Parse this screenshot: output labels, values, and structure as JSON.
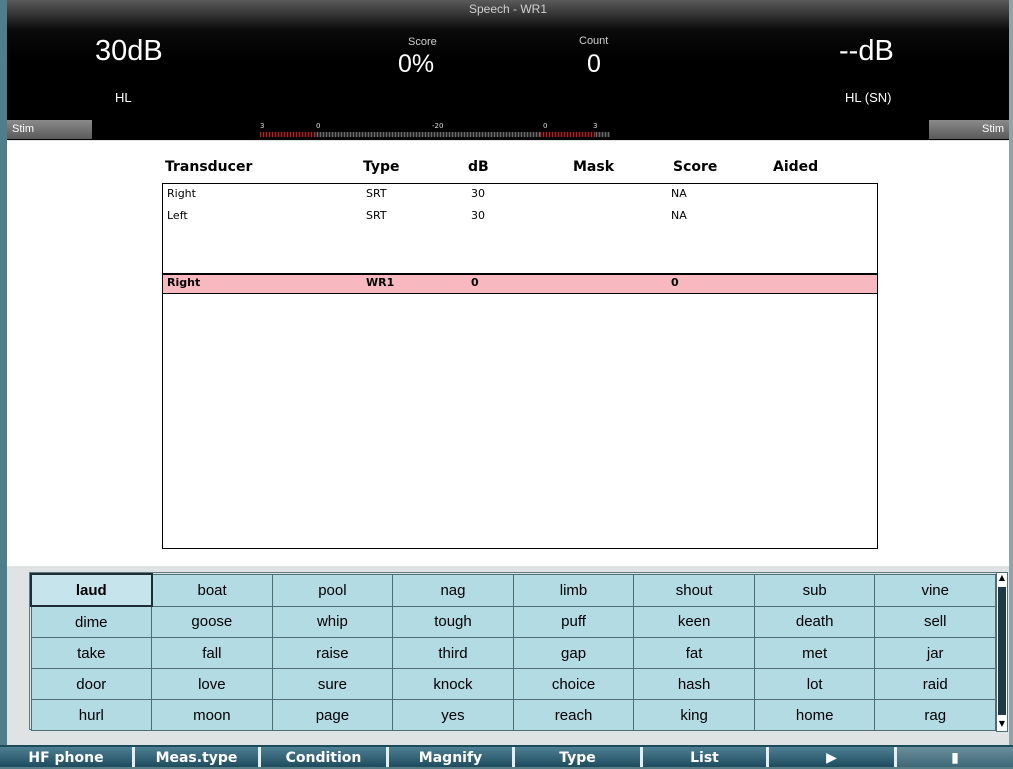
{
  "header": {
    "title": "Speech - WR1",
    "left_level": "30dB",
    "left_unit": "HL",
    "score_label": "Score",
    "score_value": "0%",
    "count_label": "Count",
    "count_value": "0",
    "right_level": "--dB",
    "right_unit": "HL (SN)"
  },
  "stim": {
    "left_label": "Stim",
    "right_label": "Stim",
    "meter_ticks": [
      "3",
      "0",
      "-20",
      "0",
      "3"
    ]
  },
  "table": {
    "headers": [
      "Transducer",
      "Type",
      "dB",
      "Mask",
      "Score",
      "Aided"
    ],
    "rows": [
      {
        "transducer": "Right",
        "type": "SRT",
        "db": "30",
        "mask": "",
        "score": "NA",
        "aided": ""
      },
      {
        "transducer": "Left",
        "type": "SRT",
        "db": "30",
        "mask": "",
        "score": "NA",
        "aided": ""
      }
    ],
    "active_row": {
      "transducer": "Right",
      "type": "WR1",
      "db": "0",
      "mask": "",
      "score": "0",
      "aided": ""
    }
  },
  "words": [
    [
      "laud",
      "boat",
      "pool",
      "nag",
      "limb",
      "shout",
      "sub",
      "vine"
    ],
    [
      "dime",
      "goose",
      "whip",
      "tough",
      "puff",
      "keen",
      "death",
      "sell"
    ],
    [
      "take",
      "fall",
      "raise",
      "third",
      "gap",
      "fat",
      "met",
      "jar"
    ],
    [
      "door",
      "love",
      "sure",
      "knock",
      "choice",
      "hash",
      "lot",
      "raid"
    ],
    [
      "hurl",
      "moon",
      "page",
      "yes",
      "reach",
      "king",
      "home",
      "rag"
    ]
  ],
  "function_keys": [
    "HF phone",
    "Meas.type",
    "Condition",
    "Magnify",
    "Type",
    "List",
    "▶",
    "▮"
  ],
  "colors": {
    "header_bg": "#000000",
    "selected_row": "#f8b8c0",
    "word_cell": "#b3dbe4",
    "function_bar": "#1c4b5c"
  }
}
